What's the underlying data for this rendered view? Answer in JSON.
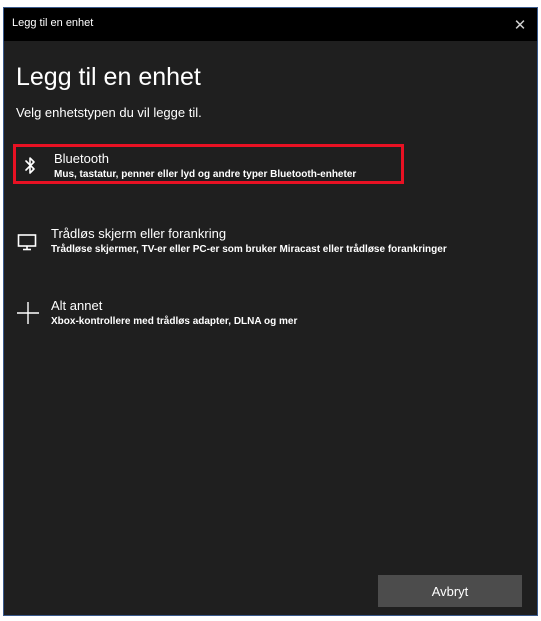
{
  "window": {
    "title": "Legg til en enhet",
    "close_icon": "close-icon"
  },
  "main": {
    "heading": "Legg til en enhet",
    "subheading": "Velg enhetstypen du vil legge til."
  },
  "options": [
    {
      "icon": "bluetooth-icon",
      "title": "Bluetooth",
      "description": "Mus, tastatur, penner eller lyd og andre typer Bluetooth-enheter"
    },
    {
      "icon": "monitor-icon",
      "title": "Trådløs skjerm eller forankring",
      "description": "Trådløse skjermer, TV-er eller PC-er som bruker Miracast eller trådløse forankringer"
    },
    {
      "icon": "plus-icon",
      "title": "Alt annet",
      "description": "Xbox-kontrollere med trådløs adapter, DLNA og mer"
    }
  ],
  "footer": {
    "cancel_label": "Avbryt"
  },
  "colors": {
    "highlight": "#e81123",
    "background": "#1f1f1f",
    "titlebar": "#000000",
    "button": "#4c4c4c"
  }
}
